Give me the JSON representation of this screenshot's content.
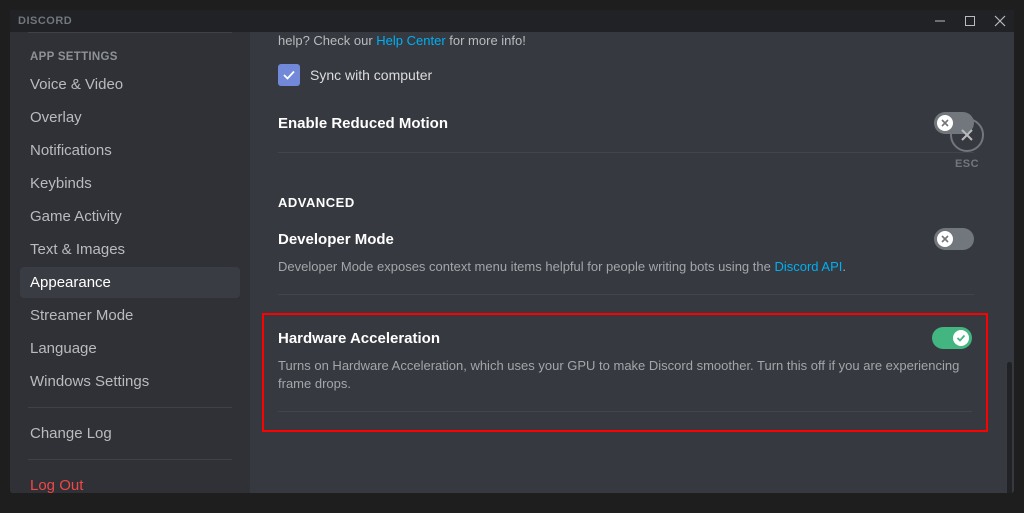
{
  "titlebar": {
    "title": "DISCORD"
  },
  "sidebar": {
    "heading": "APP SETTINGS",
    "items": [
      {
        "label": "Voice & Video"
      },
      {
        "label": "Overlay"
      },
      {
        "label": "Notifications"
      },
      {
        "label": "Keybinds"
      },
      {
        "label": "Game Activity"
      },
      {
        "label": "Text & Images"
      },
      {
        "label": "Appearance",
        "selected": true
      },
      {
        "label": "Streamer Mode"
      },
      {
        "label": "Language"
      },
      {
        "label": "Windows Settings"
      }
    ],
    "change_log": "Change Log",
    "logout": "Log Out"
  },
  "content": {
    "cutoff_prefix": "help? Check our ",
    "cutoff_link": "Help Center",
    "cutoff_suffix": " for more info!",
    "sync_label": "Sync with computer",
    "reduced_motion_title": "Enable Reduced Motion",
    "advanced_heading": "ADVANCED",
    "developer_mode": {
      "title": "Developer Mode",
      "desc_prefix": "Developer Mode exposes context menu items helpful for people writing bots using the ",
      "desc_link": "Discord API",
      "desc_suffix": "."
    },
    "hardware_accel": {
      "title": "Hardware Acceleration",
      "desc": "Turns on Hardware Acceleration, which uses your GPU to make Discord smoother. Turn this off if you are experiencing frame drops."
    }
  },
  "esc": {
    "label": "ESC"
  }
}
